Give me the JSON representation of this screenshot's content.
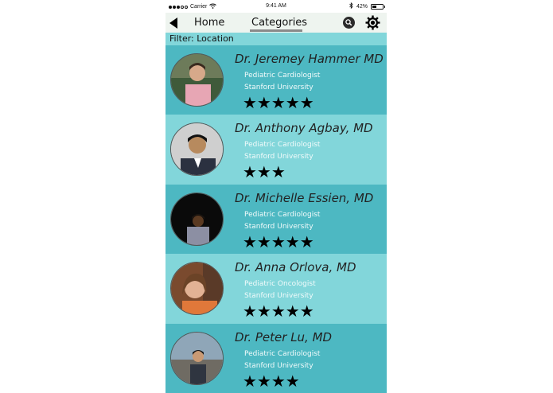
{
  "status_bar": {
    "carrier": "Carrier",
    "time": "9:41 AM",
    "battery_text": "42%",
    "battery_level": 0.42,
    "signal_bars_filled": 3,
    "signal_bars_total": 5,
    "icons": [
      "wifi-icon",
      "bluetooth-icon",
      "battery-icon"
    ]
  },
  "nav": {
    "back_icon": "back-arrow-icon",
    "home_label": "Home",
    "categories_label": "Categories",
    "search_icon": "search-icon",
    "settings_icon": "gear-icon"
  },
  "filter": {
    "label": "Filter: Location"
  },
  "colors": {
    "row_dark": "#4db8c2",
    "row_light": "#82d6da",
    "nav_bg": "#eef4ef"
  },
  "doctors": [
    {
      "name": "Dr. Jeremey Hammer MD",
      "specialty": "Pediatric Cardiologist",
      "university": "Stanford University",
      "rating": 5,
      "rating_stars": "★★★★★"
    },
    {
      "name": "Dr. Anthony Agbay, MD",
      "specialty": "Pediatric Cardiologist",
      "university": "Stanford University",
      "rating": 3,
      "rating_stars": "★★★"
    },
    {
      "name": "Dr. Michelle Essien, MD",
      "specialty": "Pediatric Cardiologist",
      "university": "Stanford University",
      "rating": 5,
      "rating_stars": "★★★★★"
    },
    {
      "name": "Dr. Anna Orlova, MD",
      "specialty": "Pediatric Oncologist",
      "university": "Stanford University",
      "rating": 5,
      "rating_stars": "★★★★★"
    },
    {
      "name": "Dr. Peter Lu, MD",
      "specialty": "Pediatric Cardiologist",
      "university": "Stanford University",
      "rating": 4,
      "rating_stars": "★★★★"
    }
  ]
}
